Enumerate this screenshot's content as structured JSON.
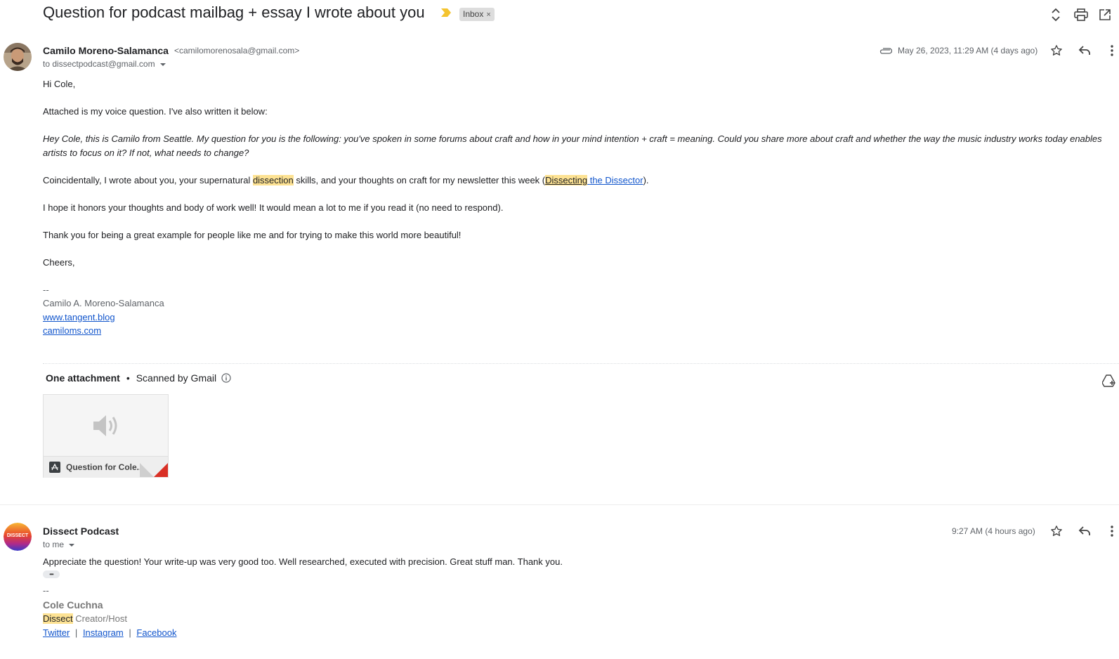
{
  "thread": {
    "subject": "Question for podcast mailbag + essay I wrote about you",
    "label": "Inbox",
    "label_remove": "×"
  },
  "colors": {
    "importance_marker": "#f4c430",
    "link": "#1155cc",
    "highlight": "#fde293",
    "attachment_corner": "#d93025"
  },
  "icons": {
    "toolbar": [
      "expand-collapse-icon",
      "print-icon",
      "open-new-window-icon"
    ],
    "message_actions": [
      "star-icon",
      "reply-icon",
      "more-vert-icon"
    ],
    "attachment_indicator": "paperclip-icon",
    "audio_preview": "speaker-icon",
    "drive_add": "add-to-drive-icon"
  },
  "message1": {
    "sender_name": "Camilo Moreno-Salamanca",
    "sender_email": "<camilomorenosala@gmail.com>",
    "to": "to dissectpodcast@gmail.com",
    "date": "May 26, 2023, 11:29 AM (4 days ago)",
    "greeting": "Hi Cole,",
    "p1": "Attached is my voice question. I've also written it below:",
    "p2_italic": "Hey Cole, this is Camilo from Seattle. My question for you is the following: you've spoken in some forums about craft and how in your mind intention + craft = meaning. Could you share more about craft and whether the way the music industry works today enables artists to focus on it? If not, what needs to change?",
    "p3": {
      "pre": "Coincidentally, I wrote about you, your supernatural ",
      "hl": "dissection",
      "mid": " skills, and your thoughts on craft for my newsletter this week (",
      "link_hl": "Dissecting",
      "link_space": " ",
      "link_rest": "the Dissector",
      "post": ")."
    },
    "p4": "I hope it honors your thoughts and body of work well! It would mean a lot to me if you read it (no need to respond).",
    "p5": "Thank you for being a great example for people like me and for trying to make this world more beautiful!",
    "closing": "Cheers,",
    "sig_dash": "--",
    "sig_name": "Camilo A. Moreno-Salamanca",
    "sig_link1": "www.tangent.blog",
    "sig_link2": "camiloms.com"
  },
  "attachments": {
    "title": "One attachment",
    "separator": "•",
    "scanned": "Scanned by Gmail",
    "info_icon": "info-icon",
    "file_name": "Question for Cole..."
  },
  "message2": {
    "sender_name": "Dissect Podcast",
    "avatar_text": "DISSECT",
    "to": "to me",
    "date": "9:27 AM (4 hours ago)",
    "body": "Appreciate the question! Your write-up was very good too. Well researched, executed with precision. Great stuff man. Thank you.",
    "show_trimmed": "•••",
    "sig_dash": "--",
    "sig_name": "Cole Cuchna",
    "sig_role_hl": "Dissect",
    "sig_role": " Creator/Host",
    "links": [
      "Twitter",
      "Instagram",
      "Facebook"
    ],
    "link_sep": "|"
  }
}
